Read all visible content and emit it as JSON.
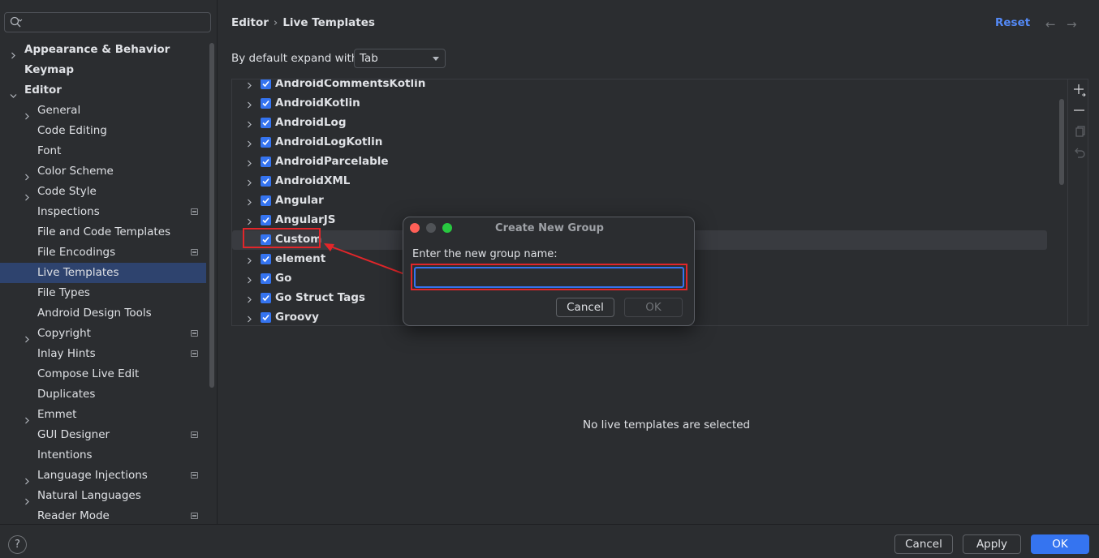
{
  "sidebar": {
    "search_placeholder": "",
    "items": [
      {
        "label": "Appearance & Behavior",
        "level": 0,
        "expandable": true,
        "expanded": false,
        "bold": true,
        "project": false
      },
      {
        "label": "Keymap",
        "level": 0,
        "expandable": false,
        "expanded": false,
        "bold": true,
        "project": false
      },
      {
        "label": "Editor",
        "level": 0,
        "expandable": true,
        "expanded": true,
        "bold": true,
        "project": false
      },
      {
        "label": "General",
        "level": 1,
        "expandable": true,
        "expanded": false,
        "bold": false,
        "project": false
      },
      {
        "label": "Code Editing",
        "level": 1,
        "expandable": false,
        "expanded": false,
        "bold": false,
        "project": false
      },
      {
        "label": "Font",
        "level": 1,
        "expandable": false,
        "expanded": false,
        "bold": false,
        "project": false
      },
      {
        "label": "Color Scheme",
        "level": 1,
        "expandable": true,
        "expanded": false,
        "bold": false,
        "project": false
      },
      {
        "label": "Code Style",
        "level": 1,
        "expandable": true,
        "expanded": false,
        "bold": false,
        "project": false
      },
      {
        "label": "Inspections",
        "level": 1,
        "expandable": false,
        "expanded": false,
        "bold": false,
        "project": true
      },
      {
        "label": "File and Code Templates",
        "level": 1,
        "expandable": false,
        "expanded": false,
        "bold": false,
        "project": false
      },
      {
        "label": "File Encodings",
        "level": 1,
        "expandable": false,
        "expanded": false,
        "bold": false,
        "project": true
      },
      {
        "label": "Live Templates",
        "level": 1,
        "expandable": false,
        "expanded": false,
        "bold": false,
        "project": false,
        "selected": true
      },
      {
        "label": "File Types",
        "level": 1,
        "expandable": false,
        "expanded": false,
        "bold": false,
        "project": false
      },
      {
        "label": "Android Design Tools",
        "level": 1,
        "expandable": false,
        "expanded": false,
        "bold": false,
        "project": false
      },
      {
        "label": "Copyright",
        "level": 1,
        "expandable": true,
        "expanded": false,
        "bold": false,
        "project": true
      },
      {
        "label": "Inlay Hints",
        "level": 1,
        "expandable": false,
        "expanded": false,
        "bold": false,
        "project": true
      },
      {
        "label": "Compose Live Edit",
        "level": 1,
        "expandable": false,
        "expanded": false,
        "bold": false,
        "project": false
      },
      {
        "label": "Duplicates",
        "level": 1,
        "expandable": false,
        "expanded": false,
        "bold": false,
        "project": false
      },
      {
        "label": "Emmet",
        "level": 1,
        "expandable": true,
        "expanded": false,
        "bold": false,
        "project": false
      },
      {
        "label": "GUI Designer",
        "level": 1,
        "expandable": false,
        "expanded": false,
        "bold": false,
        "project": true
      },
      {
        "label": "Intentions",
        "level": 1,
        "expandable": false,
        "expanded": false,
        "bold": false,
        "project": false
      },
      {
        "label": "Language Injections",
        "level": 1,
        "expandable": true,
        "expanded": false,
        "bold": false,
        "project": true
      },
      {
        "label": "Natural Languages",
        "level": 1,
        "expandable": true,
        "expanded": false,
        "bold": false,
        "project": false
      },
      {
        "label": "Reader Mode",
        "level": 1,
        "expandable": false,
        "expanded": false,
        "bold": false,
        "project": true
      }
    ]
  },
  "header": {
    "breadcrumb_root": "Editor",
    "breadcrumb_sep": "›",
    "breadcrumb_current": "Live Templates",
    "reset_label": "Reset",
    "back_arrow": "←",
    "forward_arrow": "→"
  },
  "expand": {
    "label": "By default expand with",
    "value": "Tab"
  },
  "templates": [
    {
      "name": "AndroidCommentsKotlin",
      "checked": true,
      "expandable": true
    },
    {
      "name": "AndroidKotlin",
      "checked": true,
      "expandable": true
    },
    {
      "name": "AndroidLog",
      "checked": true,
      "expandable": true
    },
    {
      "name": "AndroidLogKotlin",
      "checked": true,
      "expandable": true
    },
    {
      "name": "AndroidParcelable",
      "checked": true,
      "expandable": true
    },
    {
      "name": "AndroidXML",
      "checked": true,
      "expandable": true
    },
    {
      "name": "Angular",
      "checked": true,
      "expandable": true
    },
    {
      "name": "AngularJS",
      "checked": true,
      "expandable": true
    },
    {
      "name": "Custom",
      "checked": true,
      "expandable": false,
      "selected": true
    },
    {
      "name": "element",
      "checked": true,
      "expandable": true
    },
    {
      "name": "Go",
      "checked": true,
      "expandable": true
    },
    {
      "name": "Go Struct Tags",
      "checked": true,
      "expandable": true
    },
    {
      "name": "Groovy",
      "checked": true,
      "expandable": true
    }
  ],
  "toolbar": {
    "add_icon": "plus-icon",
    "remove_icon": "minus-icon",
    "copy_icon": "copy-icon",
    "restore_icon": "undo-icon"
  },
  "empty_message": "No live templates are selected",
  "dialog": {
    "title": "Create New Group",
    "prompt": "Enter the new group name:",
    "input_value": "",
    "cancel_label": "Cancel",
    "ok_label": "OK"
  },
  "footer": {
    "help_label": "?",
    "cancel_label": "Cancel",
    "apply_label": "Apply",
    "ok_label": "OK"
  },
  "colors": {
    "accent": "#3574f0",
    "link": "#548af7",
    "annotation": "#e2262a",
    "background": "#2b2d30"
  }
}
